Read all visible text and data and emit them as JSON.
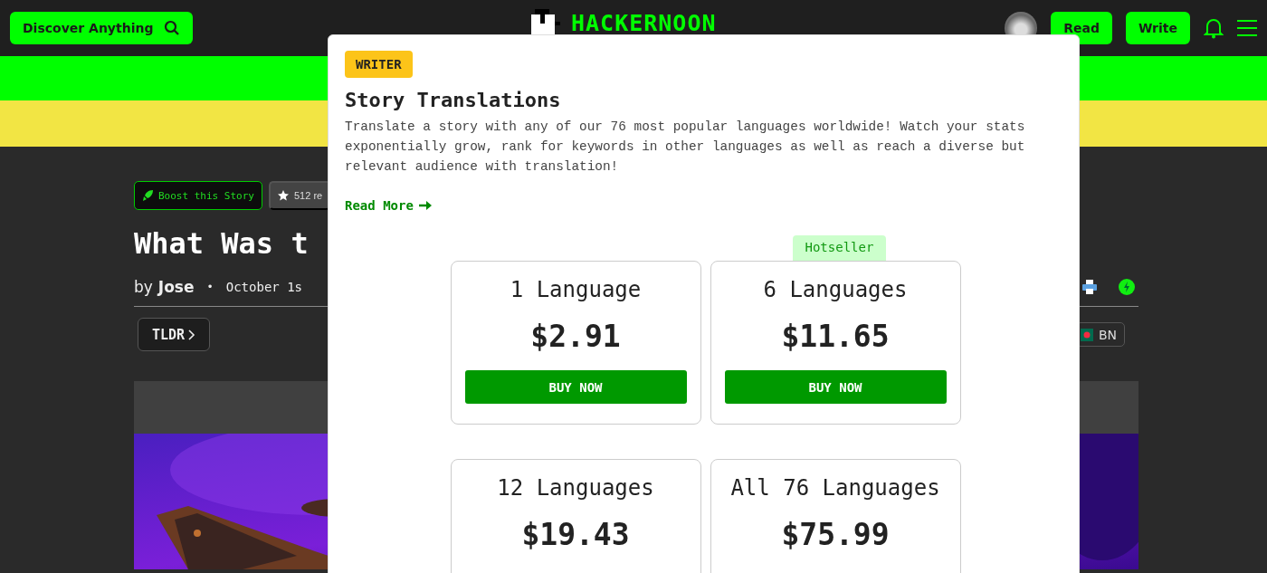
{
  "header": {
    "search_button": "Discover Anything",
    "logo": "HACKERNOON",
    "read_button": "Read",
    "write_button": "Write"
  },
  "article": {
    "boost_button": "Boost this Story",
    "reactions": "512 re",
    "title": "What Was t",
    "byline_prefix": "by",
    "author": "Jose",
    "separator": "•",
    "date": "October 1s",
    "tldr_button": "TLDR",
    "language": "BN"
  },
  "popup": {
    "badge": "WRITER",
    "title": "Story Translations",
    "description": "Translate a story with any of our 76 most popular languages worldwide! Watch your stats exponentially grow, rank for keywords in other languages as well as reach a diverse but relevant audience with translation!",
    "read_more": "Read More",
    "plan_tag": "Hotseller",
    "plans": [
      {
        "name": "1 Language",
        "price": "$2.91",
        "button": "BUY NOW"
      },
      {
        "name": "6 Languages",
        "price": "$11.65",
        "button": "BUY NOW"
      },
      {
        "name": "12 Languages",
        "price": "$19.43"
      },
      {
        "name": "All 76 Languages",
        "price": "$75.99"
      }
    ]
  }
}
